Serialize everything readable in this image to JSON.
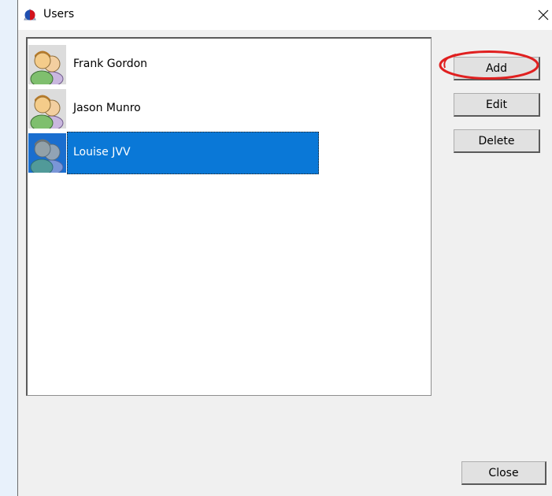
{
  "window": {
    "title": "Users"
  },
  "users": [
    {
      "name": "Frank Gordon",
      "selected": false
    },
    {
      "name": "Jason Munro",
      "selected": false
    },
    {
      "name": "Louise JVV",
      "selected": true
    }
  ],
  "buttons": {
    "add": "Add",
    "edit": "Edit",
    "delete": "Delete",
    "close": "Close"
  },
  "colors": {
    "selection": "#0a78d7",
    "annotation_ring": "#e02020"
  },
  "icons": {
    "app": "globe-app-icon",
    "user": "users-group-icon",
    "close": "close-icon"
  }
}
